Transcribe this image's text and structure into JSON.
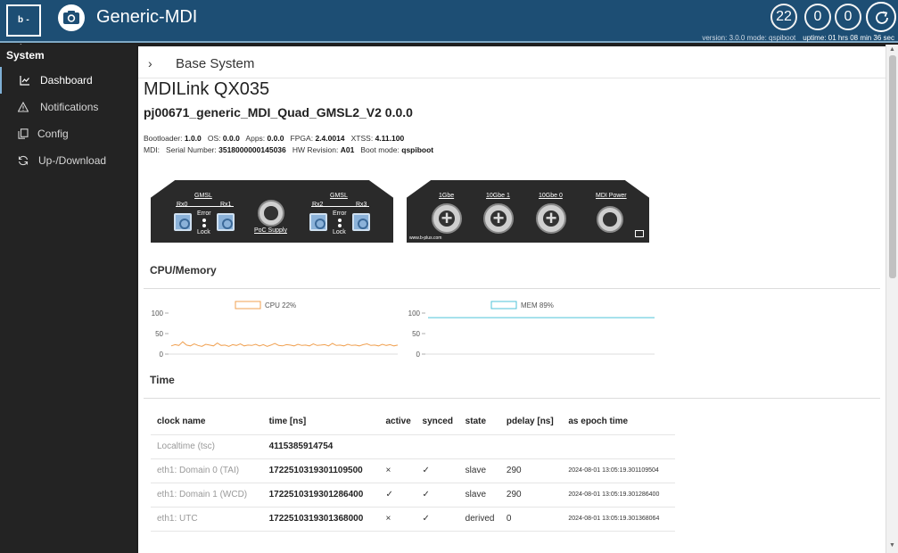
{
  "header": {
    "logo_text": "b - plus",
    "app_title": "Generic-MDI",
    "counters": [
      "22",
      "0",
      "0"
    ],
    "version_text": "version: 3.0.0 mode: qspiboot",
    "uptime_text": "uptime:  01 hrs 08 min 36 sec",
    "accent_color": "#1d4e74"
  },
  "sidebar": {
    "title": "System",
    "items": [
      {
        "label": "Dashboard",
        "icon": "chart-line-icon",
        "active": true
      },
      {
        "label": "Notifications",
        "icon": "warning-icon",
        "active": false
      },
      {
        "label": "Config",
        "icon": "copy-icon",
        "active": false
      },
      {
        "label": "Up-/Download",
        "icon": "sync-icon",
        "active": false
      }
    ]
  },
  "breadcrumb": {
    "title": "Base System"
  },
  "device": {
    "title": "MDILink QX035",
    "subtitle": "pj00671_generic_MDI_Quad_GMSL2_V2  0.0.0",
    "bootloader_label": "Bootloader:",
    "bootloader": "1.0.0",
    "os_label": "OS:",
    "os": "0.0.0",
    "apps_label": "Apps:",
    "apps": "0.0.0",
    "fpga_label": "FPGA:",
    "fpga": "2.4.0014",
    "xtss_label": "XTSS:",
    "xtss": "4.11.100",
    "mdi_label": "MDI:",
    "serial_label": "Serial Number:",
    "serial": "3518000000145036",
    "hw_label": "HW Revision:",
    "hw": "A01",
    "boot_label": "Boot mode:",
    "boot": "qspiboot"
  },
  "device_panel_a": {
    "gmsl1": "GMSL",
    "rx0": "Rx0",
    "rx1": "Rx1",
    "error1": "Error",
    "lock1": "Lock",
    "poc": "PoC Supply",
    "gmsl2": "GMSL",
    "rx2": "Rx2",
    "rx3": "Rx3",
    "error2": "Error",
    "lock2": "Lock"
  },
  "device_panel_b": {
    "p1": "1Gbe",
    "p2": "10Gbe 1",
    "p3": "10Gbe 0",
    "p4": "MDI Power",
    "url": "www.b-plus.com"
  },
  "cpu_section": {
    "title": "CPU/Memory"
  },
  "time_section": {
    "title": "Time"
  },
  "chart_data": [
    {
      "type": "line",
      "title": "",
      "series": [
        {
          "name": "CPU  22%",
          "values": [
            20,
            23,
            21,
            30,
            22,
            20,
            25,
            21,
            19,
            24,
            22,
            20,
            27,
            21,
            22,
            19,
            23,
            21,
            25,
            20,
            22,
            21,
            24,
            20,
            23,
            19,
            22,
            26,
            21,
            20,
            23,
            22,
            20,
            24,
            21,
            22,
            20,
            25,
            21,
            22,
            23,
            20,
            26,
            21,
            22,
            20,
            24,
            21,
            22,
            20,
            23,
            25,
            21,
            22,
            20,
            24,
            21,
            23,
            20,
            22
          ]
        }
      ],
      "ylim": [
        0,
        100
      ],
      "yticks": [
        "100",
        "50",
        "0"
      ],
      "color": "#f0a050"
    },
    {
      "type": "line",
      "title": "",
      "series": [
        {
          "name": "MEM  89%",
          "values": [
            89,
            89,
            89,
            89,
            89,
            89,
            89,
            89,
            89,
            89,
            89,
            89,
            89,
            89,
            89,
            89,
            89,
            89,
            89,
            89
          ]
        }
      ],
      "ylim": [
        0,
        100
      ],
      "yticks": [
        "100",
        "50",
        "0"
      ],
      "color": "#4fc3d9"
    }
  ],
  "time_table": {
    "headers": [
      "clock name",
      "time [ns]",
      "active",
      "synced",
      "state",
      "pdelay [ns]",
      "as epoch time"
    ],
    "rows": [
      [
        "Localtime (tsc)",
        "4115385914754",
        "",
        "",
        "",
        "",
        ""
      ],
      [
        "eth1: Domain 0 (TAI)",
        "1722510319301109500",
        "×",
        "✓",
        "slave",
        "290",
        "2024-08-01 13:05:19.301109504"
      ],
      [
        "eth1: Domain 1 (WCD)",
        "1722510319301286400",
        "✓",
        "✓",
        "slave",
        "290",
        "2024-08-01 13:05:19.301286400"
      ],
      [
        "eth1: UTC",
        "1722510319301368000",
        "×",
        "✓",
        "derived",
        "0",
        "2024-08-01 13:05:19.301368064"
      ]
    ]
  }
}
